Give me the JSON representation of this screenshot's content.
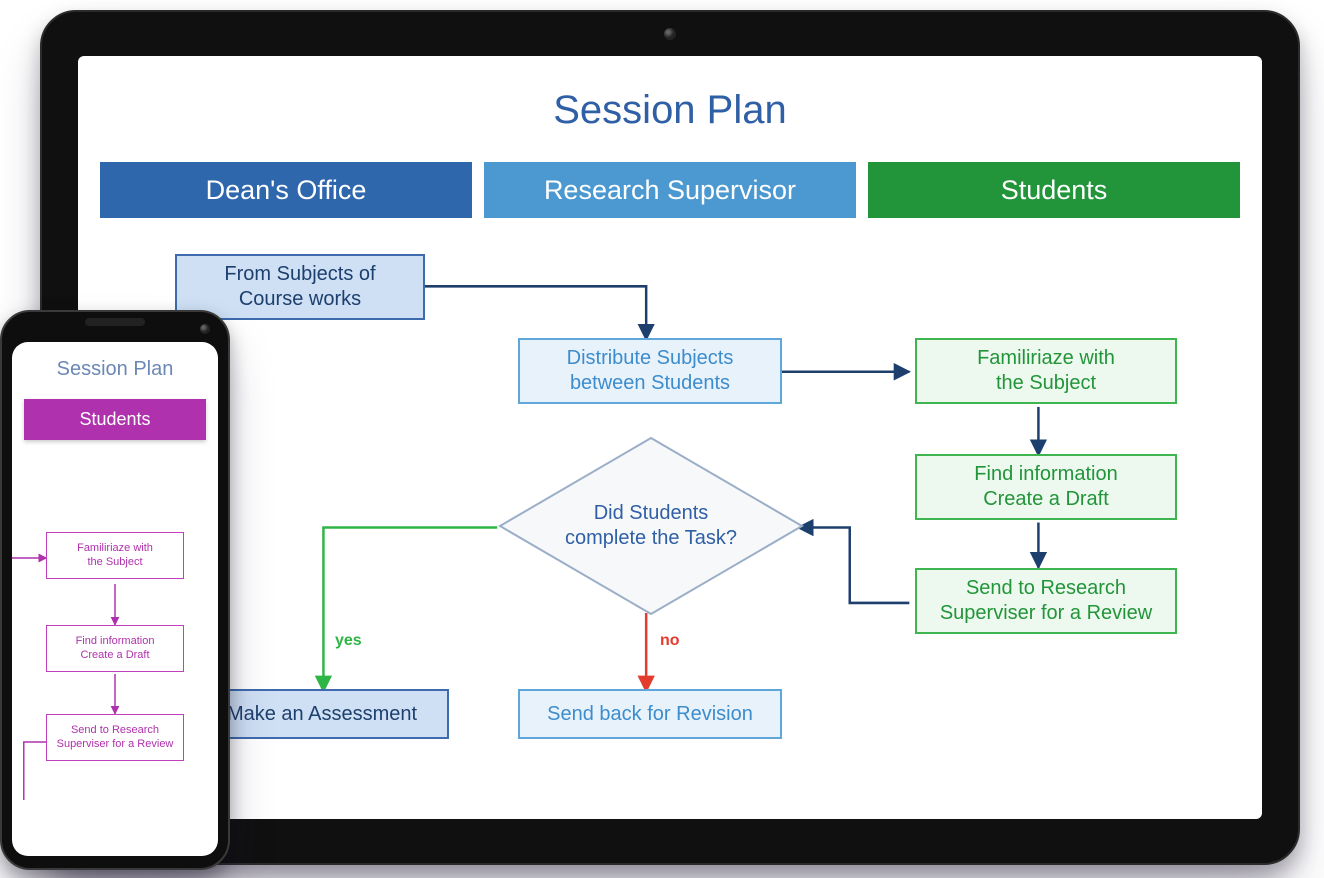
{
  "title": "Session Plan",
  "lanes": {
    "dean": "Dean's Office",
    "supervisor": "Research Supervisor",
    "students": "Students"
  },
  "nodes": {
    "from_subjects": "From Subjects of\nCourse works",
    "distribute": "Distribute Subjects\nbetween Students",
    "familiarize": "Familiriaze with\nthe Subject",
    "find_info": "Find information\nCreate a Draft",
    "send_review": "Send to Research\nSuperviser for a Review",
    "decision": "Did Students\ncomplete the Task?",
    "make_assessment": "Make an Assessment",
    "send_back": "Send back for Revision"
  },
  "edge_labels": {
    "yes": "yes",
    "no": "no"
  },
  "phone": {
    "title": "Session Plan",
    "lane": "Students",
    "nodes": {
      "familiarize": "Familiriaze with\nthe Subject",
      "find_info": "Find information\nCreate a Draft",
      "send_review": "Send to Research\nSuperviser for a Review"
    }
  },
  "colors": {
    "dean_lane": "#2f67ad",
    "supervisor_lane": "#4c98d0",
    "students_lane": "#22953a",
    "phone_lane": "#b031ae",
    "yes_arrow": "#2fb545",
    "no_arrow": "#e33b2e",
    "connector": "#1d3f6d"
  }
}
